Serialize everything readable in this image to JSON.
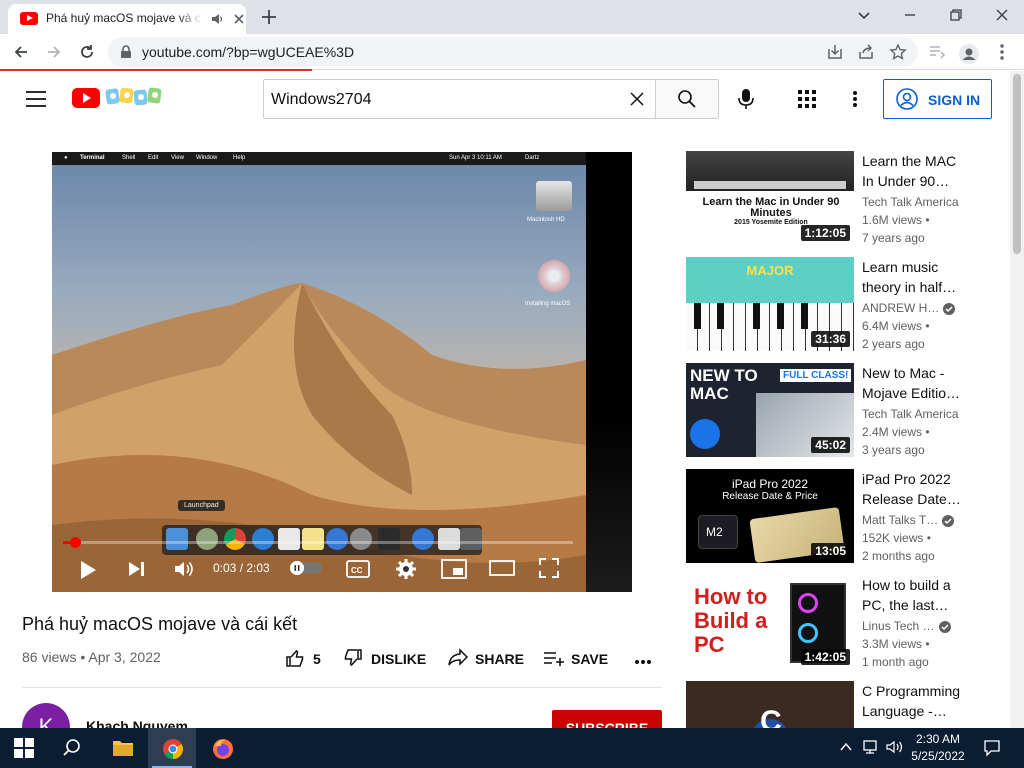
{
  "browser": {
    "tab_title": "Phá huỷ macOS mojave và cái kết",
    "url": "youtube.com/?bp=wgUCEAE%3D"
  },
  "header": {
    "search_value": "Windows2704",
    "signin_label": "SIGN IN"
  },
  "player": {
    "time": "0:03 / 2:03",
    "progress": 0.024,
    "mac_menu": [
      "Terminal",
      "Shell",
      "Edit",
      "View",
      "Window",
      "Help"
    ],
    "mac_clock": "Sun Apr 3  10:11 AM",
    "mac_user": "Dartz",
    "desktop_icon_hd": "Macintosh HD",
    "desktop_icon_cd": "Installing macOS",
    "dock_tooltip": "Launchpad"
  },
  "video": {
    "title": "Phá huỷ macOS mojave và cái kết",
    "meta": "86 views • Apr 3, 2022",
    "likes": "5",
    "dislike_label": "DISLIKE",
    "share_label": "SHARE",
    "save_label": "SAVE",
    "channel": "Khach Nguyem",
    "avatar_letter": "K",
    "subscribe_label": "SUBSCRIBE"
  },
  "recommendations": [
    {
      "title": "Learn the MAC In Under 90…",
      "channel": "Tech Talk America",
      "verified": false,
      "views": "1.6M views •",
      "age": "7 years ago",
      "duration": "1:12:05",
      "thumb_text": "Learn the Mac in Under 90 Minutes",
      "thumb_sub": "2015 Yosemite Edition"
    },
    {
      "title": "Learn music theory in half…",
      "channel": "ANDREW H…",
      "verified": true,
      "views": "6.4M views •",
      "age": "2 years ago",
      "duration": "31:36",
      "thumb_text": "MAJOR"
    },
    {
      "title": "New to Mac - Mojave Editio…",
      "channel": "Tech Talk America",
      "verified": false,
      "views": "2.4M views •",
      "age": "3 years ago",
      "duration": "45:02",
      "thumb_text": "NEW TO MAC",
      "thumb_sub": "FULL CLASS!"
    },
    {
      "title": "iPad Pro 2022 Release Date…",
      "channel": "Matt Talks T…",
      "verified": true,
      "views": "152K views •",
      "age": "2 months ago",
      "duration": "13:05",
      "thumb_text": "iPad Pro 2022",
      "thumb_sub": "Release Date & Price",
      "thumb_chip": "M2"
    },
    {
      "title": "How to build a PC, the last…",
      "channel": "Linus Tech …",
      "verified": true,
      "views": "3.3M views •",
      "age": "1 month ago",
      "duration": "1:42:05",
      "thumb_text": "How to Build a PC"
    },
    {
      "title": "C Programming Language -…",
      "channel": "",
      "verified": false,
      "views": "",
      "age": "",
      "duration": ""
    }
  ],
  "taskbar": {
    "time": "2:30 AM",
    "date": "5/25/2022"
  },
  "colors": {
    "yt_red": "#ff0000",
    "link_blue": "#065fd4",
    "subscribe_red": "#cc0000",
    "taskbar": "#0b1d33"
  }
}
